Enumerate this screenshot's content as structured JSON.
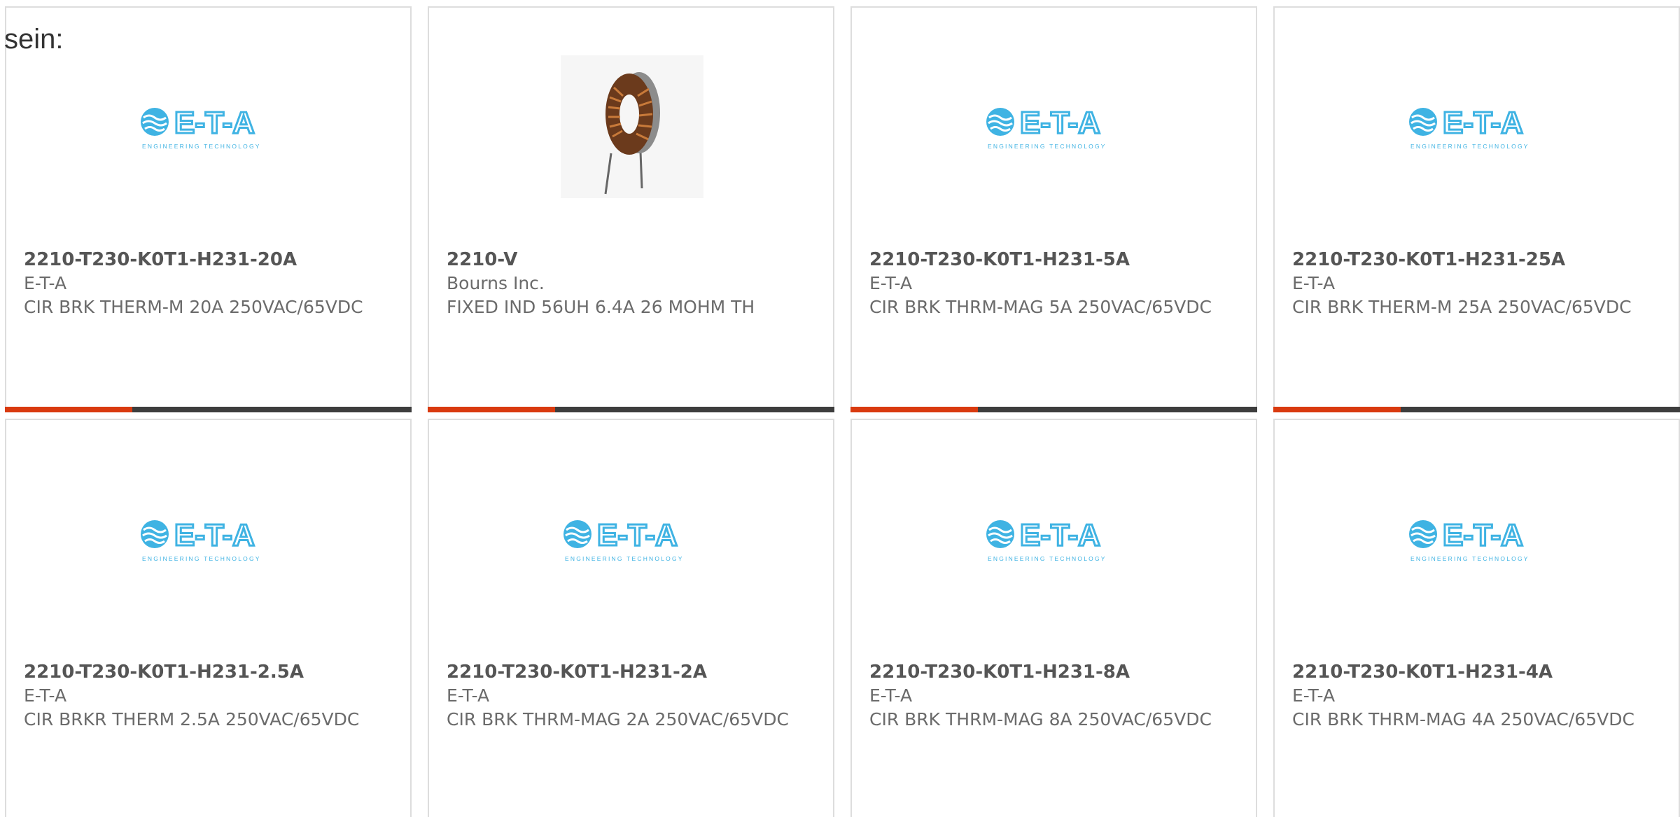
{
  "intro_text": "sein:",
  "colors": {
    "accent": "#d93a0f",
    "bar": "#3d3d3d",
    "eta_blue": "#3fb3e3"
  },
  "products": [
    {
      "part": "2210-T230-K0T1-H231-20A",
      "manufacturer": "E-T-A",
      "description": "CIR BRK THERM-M 20A 250VAC/65VDC",
      "image": "eta-logo"
    },
    {
      "part": "2210-V",
      "manufacturer": "Bourns Inc.",
      "description": "FIXED IND 56UH 6.4A 26 MOHM TH",
      "image": "toroid-inductor-photo"
    },
    {
      "part": "2210-T230-K0T1-H231-5A",
      "manufacturer": "E-T-A",
      "description": "CIR BRK THRM-MAG 5A 250VAC/65VDC",
      "image": "eta-logo"
    },
    {
      "part": "2210-T230-K0T1-H231-25A",
      "manufacturer": "E-T-A",
      "description": "CIR BRK THERM-M 25A 250VAC/65VDC",
      "image": "eta-logo"
    },
    {
      "part": "2210-T230-K0T1-H231-2.5A",
      "manufacturer": "E-T-A",
      "description": "CIR BRKR THERM 2.5A 250VAC/65VDC",
      "image": "eta-logo"
    },
    {
      "part": "2210-T230-K0T1-H231-2A",
      "manufacturer": "E-T-A",
      "description": "CIR BRK THRM-MAG 2A 250VAC/65VDC",
      "image": "eta-logo"
    },
    {
      "part": "2210-T230-K0T1-H231-8A",
      "manufacturer": "E-T-A",
      "description": "CIR BRK THRM-MAG 8A 250VAC/65VDC",
      "image": "eta-logo"
    },
    {
      "part": "2210-T230-K0T1-H231-4A",
      "manufacturer": "E-T-A",
      "description": "CIR BRK THRM-MAG 4A 250VAC/65VDC",
      "image": "eta-logo"
    }
  ],
  "eta_logo": {
    "wordmark": "E-T-A",
    "tagline": "ENGINEERING TECHNOLOGY"
  }
}
